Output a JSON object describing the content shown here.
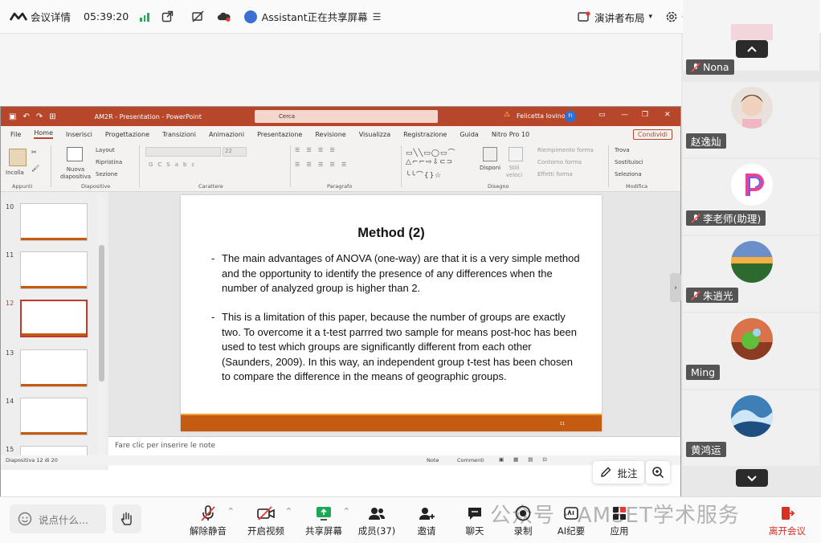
{
  "topbar": {
    "meeting_details": "会议详情",
    "time": "05:39:20",
    "sharing_text": "Assistant正在共享屏幕",
    "presenter_layout": "演讲者布局",
    "settings": "设置"
  },
  "powerpoint": {
    "title": "AM2R - Presentation  -  PowerPoint",
    "search_placeholder": "Cerca",
    "user": "Felicetta Iovino",
    "user_initials": "FI",
    "menu": [
      "File",
      "Home",
      "Inserisci",
      "Progettazione",
      "Transizioni",
      "Animazioni",
      "Presentazione",
      "Revisione",
      "Visualizza",
      "Registrazione",
      "Guida",
      "Nitro Pro 10"
    ],
    "share_label": "Condividi",
    "ribbon": {
      "incolla": "Incolla",
      "nuova_diapositiva": "Nuova diapositiva",
      "layout": "Layout",
      "ripristina": "Ripristina",
      "sezione": "Sezione",
      "disponi": "Disponi",
      "stili_veloci": "Stili veloci",
      "riempimento": "Riempimento forma",
      "contorno": "Contorno forma",
      "effetti": "Effetti forma",
      "trova": "Trova",
      "sostituisci": "Sostituisci",
      "seleziona": "Seleziona",
      "groups": [
        "Appunti",
        "Diapositive",
        "Carattere",
        "Paragrafo",
        "Disegno",
        "Modifica"
      ],
      "font_size": "22"
    },
    "thumbnail_numbers": [
      "10",
      "11",
      "12",
      "13",
      "14",
      "15"
    ],
    "slide": {
      "title": "Method (2)",
      "bullets": [
        "The main advantages of ANOVA (one-way) are that it is a very simple method and the opportunity to identify the presence of any differences when the number  of analyzed group is higher than 2.",
        "This is a limitation of this paper, because the number of groups are exactly two. To overcome it  a t-test  parrred two sample for means post-hoc has been used to test which groups are significantly different from each other (Saunders, 2009). In this way, an independent group t-test has been chosen to compare the difference in the means of geographic groups."
      ],
      "number": "11"
    },
    "notes_placeholder": "Fare clic per inserire le note",
    "status_slide": "Diapositiva 12 di 20",
    "status_note": "Note",
    "status_comments": "Commenti"
  },
  "overlay": {
    "annotate": "批注"
  },
  "participants": [
    {
      "name": "Nona",
      "muted": true
    },
    {
      "name": "赵逸灿",
      "muted": false
    },
    {
      "name": "李老师(助理)",
      "muted": true
    },
    {
      "name": "朱逍光",
      "muted": true
    },
    {
      "name": "Ming",
      "muted": false
    },
    {
      "name": "黄鸿运",
      "muted": false
    }
  ],
  "bottombar": {
    "say_placeholder": "说点什么...",
    "unmute": "解除静音",
    "start_video": "开启视频",
    "share_screen": "共享屏幕",
    "members": "成员(37)",
    "invite": "邀请",
    "chat": "聊天",
    "record": "录制",
    "ai_minutes": "AI纪要",
    "apps": "应用",
    "leave": "离开会议",
    "watermark": "公众号 · AMSET学术服务"
  },
  "colors": {
    "ppt_accent": "#b7472a",
    "slide_footer": "#c55a11",
    "signal_green": "#1fb05a",
    "leave_red": "#d93025"
  }
}
